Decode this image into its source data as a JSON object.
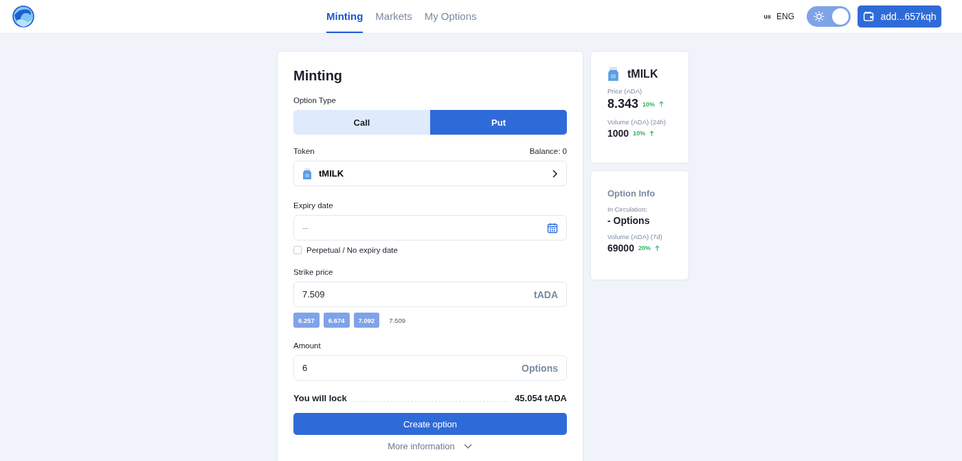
{
  "nav": {
    "tabs": [
      {
        "label": "Minting",
        "selected": true
      },
      {
        "label": "Markets",
        "selected": false
      },
      {
        "label": "My Options",
        "selected": false
      }
    ],
    "locale_flag": "us",
    "language": "ENG",
    "theme_toggle": {
      "on": true
    },
    "wallet": "add...657kqh"
  },
  "minting": {
    "title": "Minting",
    "option_type_label": "Option Type",
    "option_types": [
      {
        "label": "Call",
        "selected": false
      },
      {
        "label": "Put",
        "selected": true
      }
    ],
    "token_label": "Token",
    "balance": "Balance: 0",
    "token": "tMILK",
    "expiry_label": "Expiry date",
    "expiry_placeholder": "--",
    "perpetual": {
      "label": "Perpetual / No expiry date",
      "checked": false
    },
    "strike_label": "Strike price",
    "strike_value": "7.509",
    "strike_unit": "tADA",
    "strike_presets": [
      {
        "label": "6.257",
        "kind": "chip"
      },
      {
        "label": "6.674",
        "kind": "chip"
      },
      {
        "label": "7.092",
        "kind": "chip"
      },
      {
        "label": "7.509",
        "kind": "plain"
      }
    ],
    "amount_label": "Amount",
    "amount_value": "6",
    "amount_unit": "Options",
    "lock_label": "You will lock",
    "lock_value": "45.054 tADA",
    "create_button": "Create option",
    "more_info": "More information"
  },
  "token_card": {
    "name": "tMILK",
    "stats": [
      {
        "label": "Price (ADA)",
        "value": "8.343",
        "change": "10%",
        "kind": "large"
      },
      {
        "label": "Volume (ADA) (24h)",
        "value": "1000",
        "change": "10%",
        "kind": "normal"
      }
    ]
  },
  "option_info": {
    "title": "Option Info",
    "circulation_label": "In Circulation:",
    "circulation_value": "- Options",
    "volume_label": "Volume (ADA) (7d)",
    "volume_value": "69000",
    "volume_change": "20%"
  }
}
